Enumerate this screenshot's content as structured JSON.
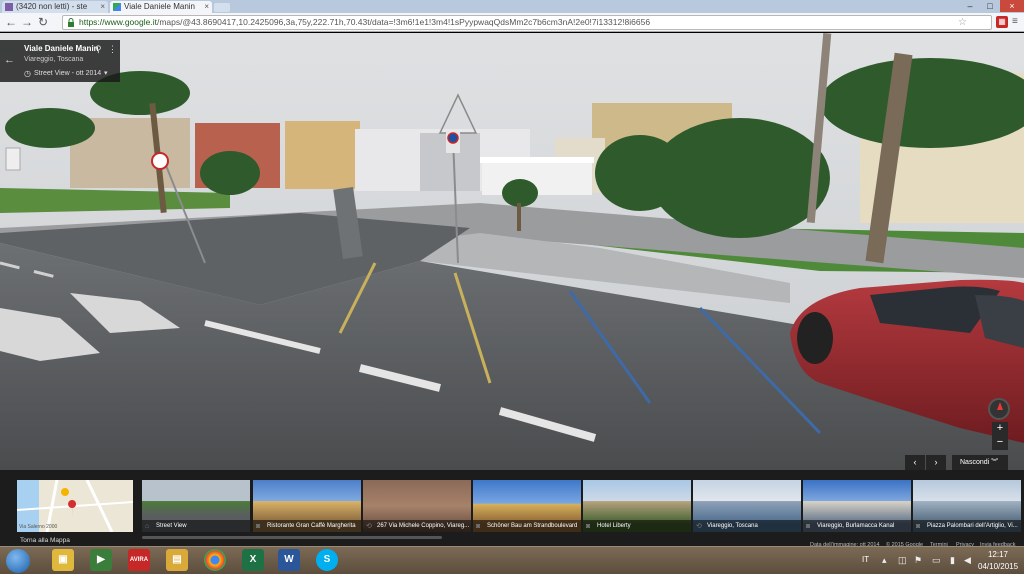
{
  "browser": {
    "tabs": [
      {
        "label": "(3420 non letti) - ste",
        "active": false
      },
      {
        "label": "Viale Daniele Manin",
        "active": true
      }
    ],
    "url_host": "https://www.google.it",
    "url_path": "/maps/@43.8690417,10.2425096,3a,75y,222.71h,70.43t/data=!3m6!1e1!3m4!1sPyypwaqQdsMm2c7b6cm3nA!2e0!7i13312!8i6656"
  },
  "infocard": {
    "title": "Viale Daniele Manin",
    "subtitle": "Viareggio, Toscana",
    "date": "Street View - ott 2014"
  },
  "controls": {
    "zoom_in": "+",
    "zoom_out": "−",
    "hide_label": "Nascondi",
    "prev": "‹",
    "next": "›"
  },
  "filmstrip": {
    "map_label": "Torna alla Mappa",
    "map_street": "Via Salerno 2000",
    "thumbs": [
      {
        "caption": "Street View",
        "icon": "street-view"
      },
      {
        "caption": "Ristorante Gran Caffè Margherita",
        "icon": "camera"
      },
      {
        "caption": "267 Via Michele Coppino, Viareg...",
        "icon": "pano"
      },
      {
        "caption": "Schöner Bau am Strandboulevard",
        "icon": "camera"
      },
      {
        "caption": "Hotel Liberty",
        "icon": "camera"
      },
      {
        "caption": "Viareggio, Toscana",
        "icon": "pano"
      },
      {
        "caption": "Viareggio, Burlamacca Kanal",
        "icon": "camera"
      },
      {
        "caption": "Piazza Palombari dell'Artiglio, Vi...",
        "icon": "camera"
      }
    ],
    "footer": {
      "imagery": "Data dell'immagine: ott 2014",
      "copyright": "© 2015 Google",
      "terms": "Termini",
      "privacy": "Privacy",
      "feedback": "Invia feedback"
    }
  },
  "taskbar": {
    "language": "IT",
    "time": "12:17",
    "date": "04/10/2015",
    "apps": [
      "explorer",
      "media-player",
      "avira",
      "file-manager",
      "chrome",
      "excel",
      "word",
      "skype"
    ],
    "avira_label": "AVIRA",
    "excel_label": "X",
    "word_label": "W",
    "skype_label": "S"
  }
}
